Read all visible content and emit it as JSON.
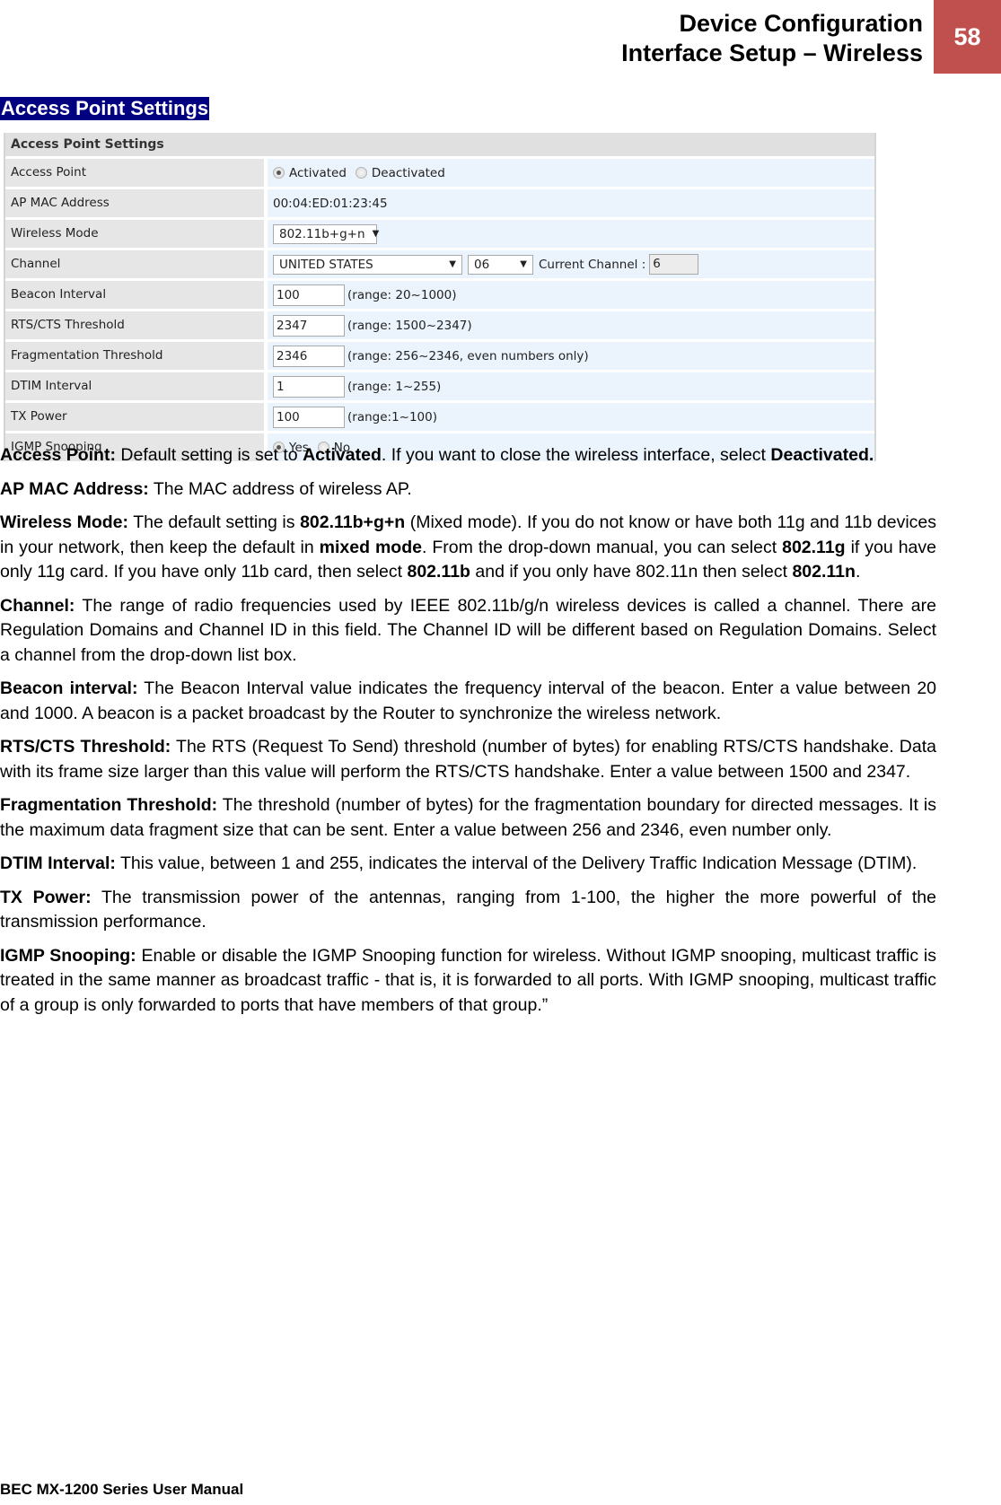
{
  "header": {
    "title_line1": "Device Configuration",
    "title_line2": "Interface Setup – Wireless",
    "page_number": "58",
    "accent_color": "#c0504d"
  },
  "section_heading": "Access Point Settings",
  "form": {
    "title": "Access Point Settings",
    "rows": {
      "access_point": {
        "label": "Access Point",
        "options": [
          {
            "label": "Activated",
            "checked": true
          },
          {
            "label": "Deactivated",
            "checked": false
          }
        ]
      },
      "ap_mac": {
        "label": "AP MAC Address",
        "value": "00:04:ED:01:23:45"
      },
      "wireless_mode": {
        "label": "Wireless Mode",
        "selected": "802.11b+g+n"
      },
      "channel": {
        "label": "Channel",
        "domain_selected": "UNITED STATES",
        "channel_selected": "06",
        "current_channel_label": "Current Channel :",
        "current_channel_value": "6"
      },
      "beacon_interval": {
        "label": "Beacon Interval",
        "value": "100",
        "hint": "(range: 20~1000)"
      },
      "rts_cts": {
        "label": "RTS/CTS Threshold",
        "value": "2347",
        "hint": "(range: 1500~2347)"
      },
      "fragmentation": {
        "label": "Fragmentation Threshold",
        "value": "2346",
        "hint": "(range: 256~2346, even numbers only)"
      },
      "dtim": {
        "label": "DTIM Interval",
        "value": "1",
        "hint": "(range: 1~255)"
      },
      "tx_power": {
        "label": "TX Power",
        "value": "100",
        "hint": "(range:1~100)"
      },
      "igmp": {
        "label": "IGMP Snooping",
        "options": [
          {
            "label": "Yes",
            "checked": true
          },
          {
            "label": "No",
            "checked": false
          }
        ]
      }
    }
  },
  "descriptions": {
    "access_point": {
      "term": "Access Point:",
      "t1": " Default setting is set to ",
      "b1": "Activated",
      "t2": ". If you want to close the wireless interface, select ",
      "b2": "Deactivated."
    },
    "ap_mac": {
      "term": "AP MAC Address:",
      "t1": " The MAC address of wireless AP."
    },
    "wireless_mode": {
      "term": "Wireless Mode:",
      "t1": " The default setting is ",
      "b1": "802.11b+g+n",
      "t2": " (Mixed mode). If you do not know or have both 11g and 11b devices in your network, then keep the default in ",
      "b2": "mixed mode",
      "t3": ". From the drop-down manual, you can select ",
      "b3": "802.11g",
      "t4": " if you have only 11g card.  If you have only 11b card, then select ",
      "b4": "802.11b",
      "t5": " and if you only have 802.11n then select ",
      "b5": "802.11n",
      "t6": "."
    },
    "channel": {
      "term": "Channel:",
      "t1": " The range of radio frequencies used by IEEE 802.11b/g/n wireless devices is called a channel. There are Regulation Domains and Channel ID in this field. The Channel ID will be different based on Regulation Domains. Select a channel from the drop-down list box."
    },
    "beacon": {
      "term": "Beacon interval:",
      "t1": " The Beacon Interval value indicates the frequency interval of the beacon. Enter a value between 20 and 1000. A beacon is a packet broadcast by the Router to synchronize the wireless network."
    },
    "rts": {
      "term": "RTS/CTS Threshold:",
      "t1": " The RTS (Request To Send) threshold (number of bytes) for enabling RTS/CTS handshake. Data with its frame size larger than this value will perform the RTS/CTS handshake. Enter a value between 1500 and 2347."
    },
    "fragmentation": {
      "term": "Fragmentation Threshold:",
      "t1": " The threshold (number of bytes) for the fragmentation boundary for directed messages. It is the maximum data fragment size that can be sent. Enter a value between 256 and 2346, even number only."
    },
    "dtim": {
      "term": "DTIM Interval:",
      "t1": " This value, between 1 and 255, indicates the interval of the Delivery Traffic Indication Message (DTIM)."
    },
    "tx_power": {
      "term": "TX Power:",
      "t1": " The transmission power of the antennas, ranging from 1-100, the higher the more powerful of the transmission performance."
    },
    "igmp": {
      "term": "IGMP Snooping:",
      "t1": " Enable or disable the IGMP Snooping function for wireless. Without IGMP snooping, multicast traffic is treated in the same manner as broadcast traffic - that is, it is forwarded to all ports. With IGMP snooping, multicast traffic of a group is only forwarded to ports that have members of that group.”"
    }
  },
  "footer": "BEC MX-1200 Series User Manual"
}
